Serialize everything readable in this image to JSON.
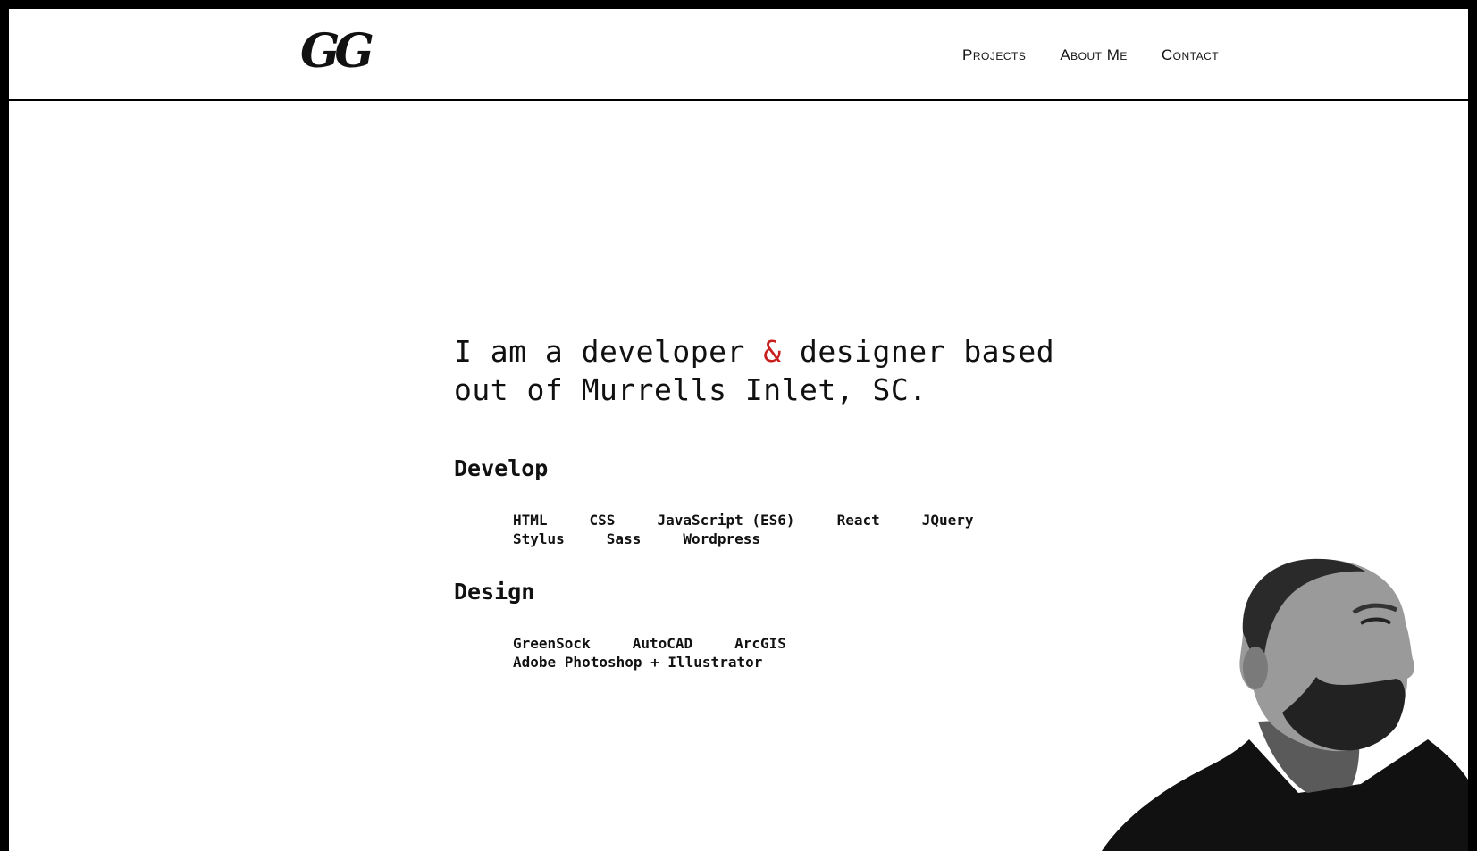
{
  "header": {
    "logo_text": "GG",
    "nav": [
      {
        "label": "Projects"
      },
      {
        "label": "About Me"
      },
      {
        "label": "Contact"
      }
    ]
  },
  "intro": {
    "before_amp": "I am a developer ",
    "amp": "&",
    "after_amp": " designer based out of Murrells Inlet, SC."
  },
  "develop": {
    "title": "Develop",
    "line1": [
      "HTML",
      "CSS",
      "JavaScript (ES6)",
      "React",
      "JQuery"
    ],
    "line2": [
      "Stylus",
      "Sass",
      "Wordpress"
    ]
  },
  "design": {
    "title": "Design",
    "line1": [
      "GreenSock",
      "AutoCAD",
      "ArcGIS"
    ],
    "line2": [
      "Adobe Photoshop + Illustrator"
    ]
  },
  "colors": {
    "accent": "#c8201f",
    "border": "#000000"
  },
  "icons": {
    "portrait": "profile-photo"
  }
}
